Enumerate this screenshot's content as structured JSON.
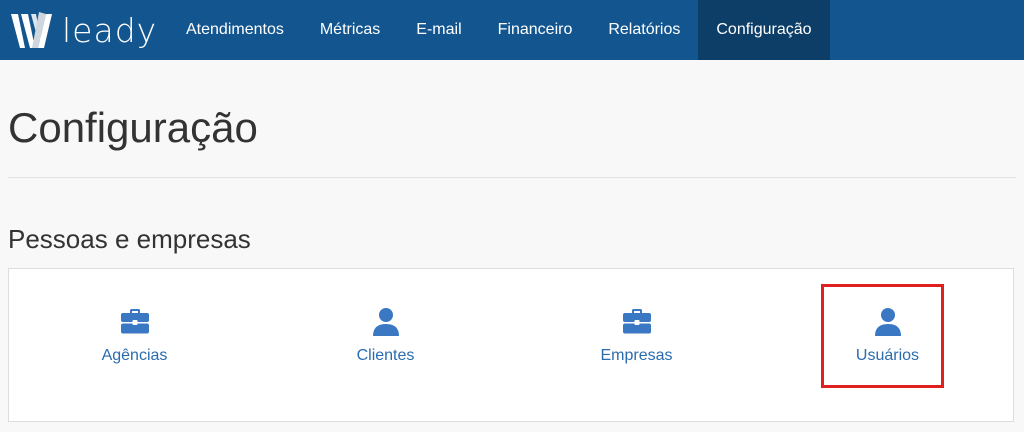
{
  "brand": {
    "name": "leady"
  },
  "nav": {
    "items": [
      {
        "label": "Atendimentos"
      },
      {
        "label": "Métricas"
      },
      {
        "label": "E-mail"
      },
      {
        "label": "Financeiro"
      },
      {
        "label": "Relatórios"
      },
      {
        "label": "Configuração",
        "active": true
      }
    ]
  },
  "page": {
    "title": "Configuração"
  },
  "section": {
    "title": "Pessoas e empresas",
    "tiles": [
      {
        "label": "Agências",
        "icon": "briefcase-icon"
      },
      {
        "label": "Clientes",
        "icon": "user-icon"
      },
      {
        "label": "Empresas",
        "icon": "briefcase-icon"
      },
      {
        "label": "Usuários",
        "icon": "user-icon",
        "highlighted": true
      }
    ]
  },
  "colors": {
    "navbar": "#13568f",
    "nav_active": "#0d3e67",
    "link": "#2a6cae",
    "icon": "#3a78c3",
    "highlight": "#e0201f"
  }
}
